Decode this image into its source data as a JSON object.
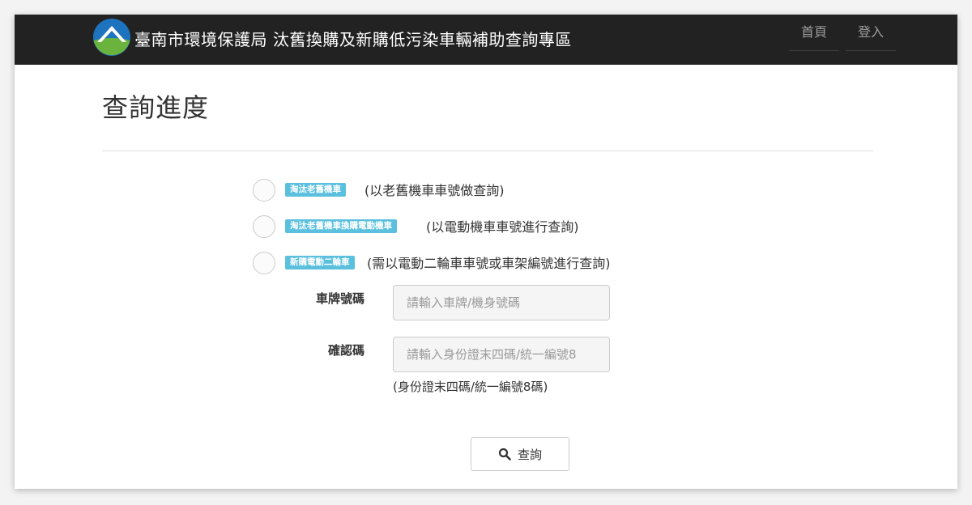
{
  "header": {
    "site_title": "臺南市環境保護局 汰舊換購及新購低污染車輛補助查詢專區",
    "nav": {
      "home": "首頁",
      "login": "登入"
    },
    "logo_icon": "tainan-epb-logo",
    "colors": {
      "bar": "#222222",
      "logo_blue": "#1e73be",
      "logo_green": "#6ab43e"
    }
  },
  "page": {
    "title": "查詢進度"
  },
  "query_types": [
    {
      "badge": "淘汰老舊機車",
      "description": "(以老舊機車車號做查詢)"
    },
    {
      "badge": "淘汰老舊機車換購電動機車",
      "description": "(以電動機車車號進行查詢)"
    },
    {
      "badge": "新購電動二輪車",
      "description": "(需以電動二輪車車號或車架編號進行查詢)"
    }
  ],
  "form": {
    "plate": {
      "label": "車牌號碼",
      "placeholder": "請輸入車牌/機身號碼",
      "value": ""
    },
    "verify": {
      "label": "確認碼",
      "placeholder": "請輸入身份證末四碼/統一編號8",
      "value": "",
      "help": "(身份證末四碼/統一編號8碼)"
    },
    "submit": {
      "label": "查詢",
      "icon": "search-icon"
    }
  },
  "colors": {
    "badge": "#5bc0de"
  }
}
